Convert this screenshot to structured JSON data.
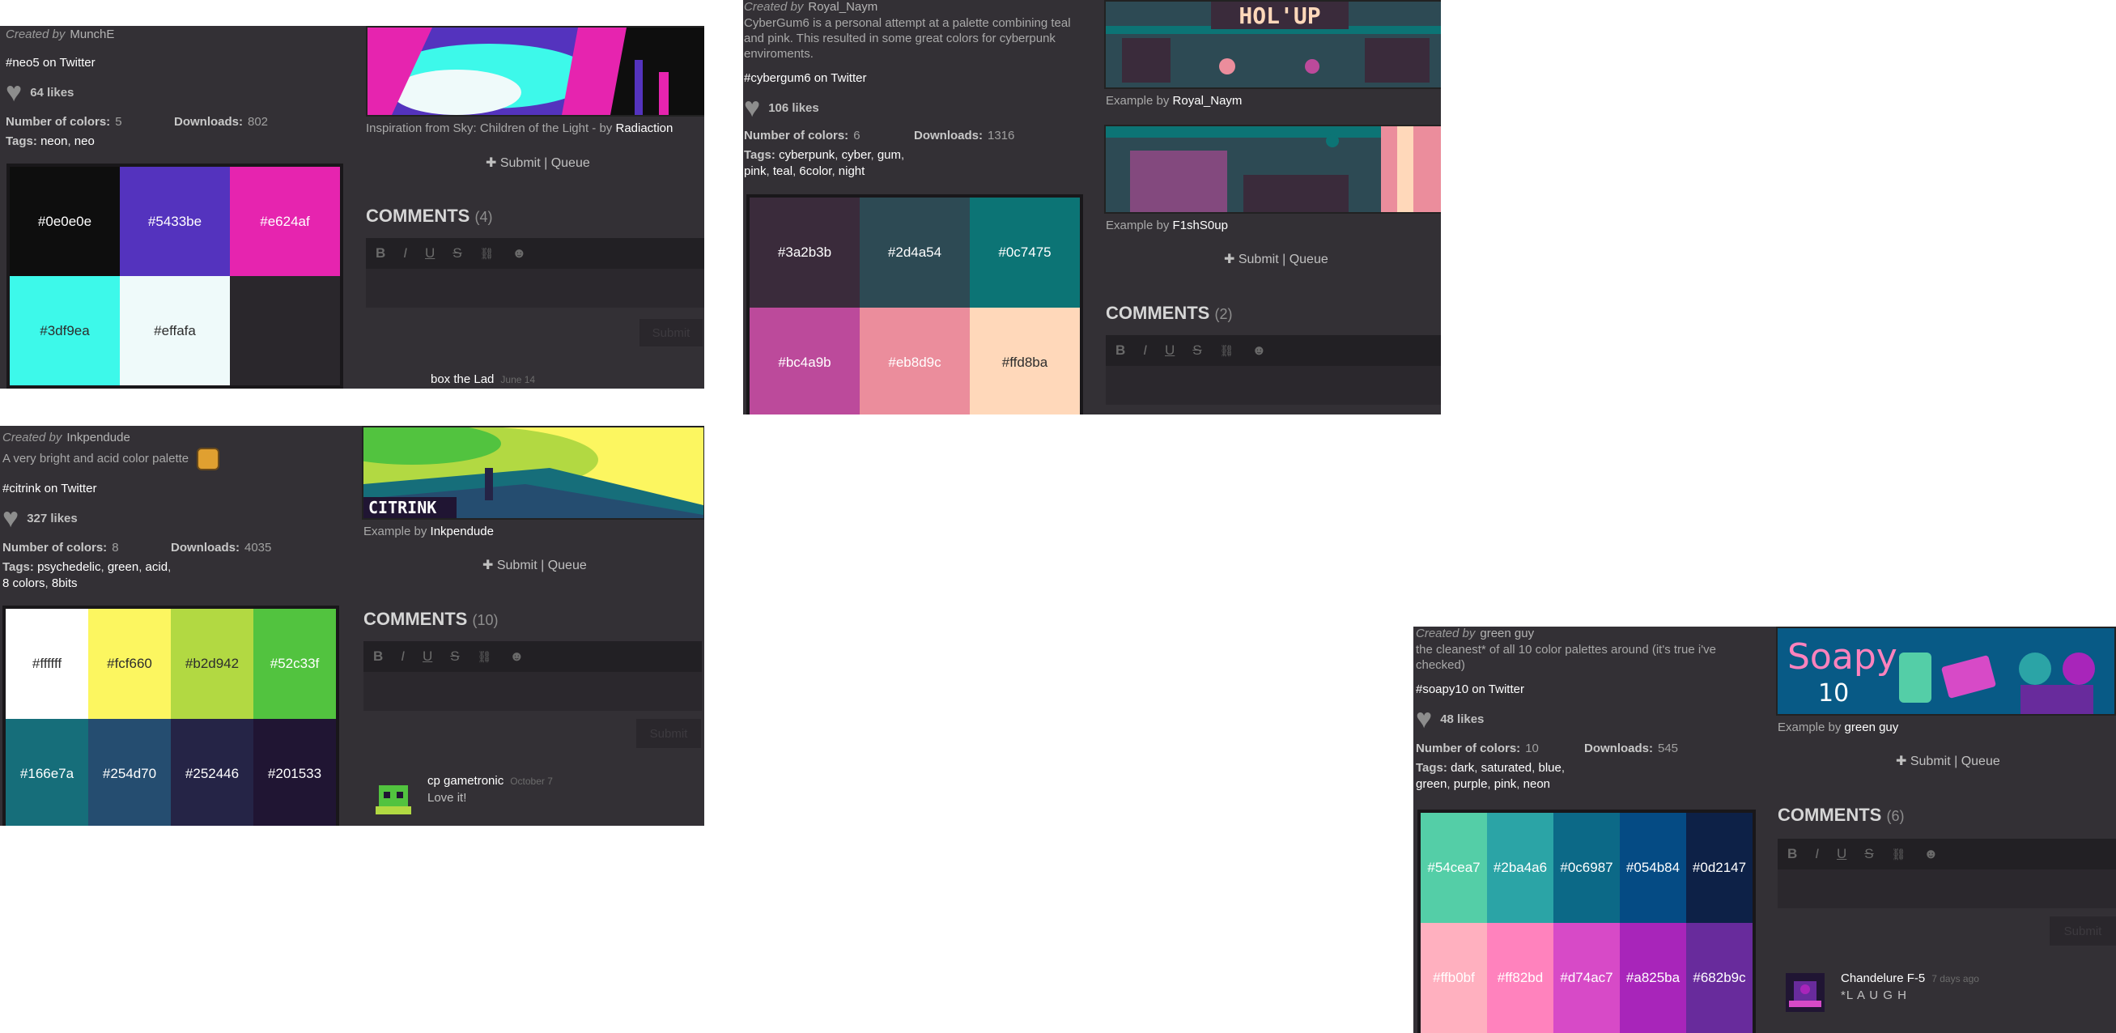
{
  "p1": {
    "created_by_label": "Created by",
    "creator": "MunchE",
    "twitter": "#neo5 on Twitter",
    "likes": "64 likes",
    "num_colors_label": "Number of colors:",
    "num_colors": "5",
    "downloads_label": "Downloads:",
    "downloads": "802",
    "tags_label": "Tags:",
    "tags": [
      "neon",
      "neo"
    ],
    "colors": [
      "#0e0e0e",
      "#5433be",
      "#e624af",
      "#3df9ea",
      "#effafa"
    ],
    "example_caption": "Inspiration from Sky: Children of the Light - by",
    "example_author": "Radiaction",
    "submit": "✚ Submit | Queue",
    "comments_label": "COMMENTS",
    "comments_count": "(4)",
    "submit_btn": "Submit",
    "comment_author": "box the Lad",
    "comment_date": "June 14"
  },
  "p2": {
    "created_by_label": "Created by",
    "creator": "Royal_Naym",
    "description": "CyberGum6 is a personal attempt at a palette combining teal and pink. This resulted in some great colors for cyberpunk enviroments.",
    "twitter": "#cybergum6 on Twitter",
    "likes": "106 likes",
    "num_colors_label": "Number of colors:",
    "num_colors": "6",
    "downloads_label": "Downloads:",
    "downloads": "1316",
    "tags_label": "Tags:",
    "tags": [
      "cyberpunk",
      "cyber",
      "gum",
      "pink",
      "teal",
      "6color",
      "night"
    ],
    "colors": [
      "#3a2b3b",
      "#2d4a54",
      "#0c7475",
      "#bc4a9b",
      "#eb8d9c",
      "#ffd8ba"
    ],
    "banner_text": "HOL'UP",
    "example1_prefix": "Example by",
    "example1_author": "Royal_Naym",
    "example2_prefix": "Example by",
    "example2_author": "F1shS0up",
    "submit": "✚ Submit | Queue",
    "comments_label": "COMMENTS",
    "comments_count": "(2)"
  },
  "p3": {
    "created_by_label": "Created by",
    "creator": "Inkpendude",
    "description": "A very bright and acid color palette",
    "twitter": "#citrink on Twitter",
    "likes": "327 likes",
    "num_colors_label": "Number of colors:",
    "num_colors": "8",
    "downloads_label": "Downloads:",
    "downloads": "4035",
    "tags_label": "Tags:",
    "tags": [
      "psychedelic",
      "green",
      "acid",
      "8 colors",
      "8bits"
    ],
    "colors": [
      "#ffffff",
      "#fcf660",
      "#b2d942",
      "#52c33f",
      "#166e7a",
      "#254d70",
      "#252446",
      "#201533"
    ],
    "banner_text": "CITRINK",
    "example_prefix": "Example by",
    "example_author": "Inkpendude",
    "submit": "✚ Submit | Queue",
    "comments_label": "COMMENTS",
    "comments_count": "(10)",
    "submit_btn": "Submit",
    "comment_author": "cp gametronic",
    "comment_date": "October 7",
    "comment_text": "Love it!"
  },
  "p4": {
    "created_by_label": "Created by",
    "creator": "green guy",
    "description": "the cleanest* of all 10 color palettes around (it's true i've checked)",
    "twitter": "#soapy10 on Twitter",
    "likes": "48 likes",
    "num_colors_label": "Number of colors:",
    "num_colors": "10",
    "downloads_label": "Downloads:",
    "downloads": "545",
    "tags_label": "Tags:",
    "tags": [
      "dark",
      "saturated",
      "blue",
      "green",
      "purple",
      "pink",
      "neon"
    ],
    "colors": [
      "#54cea7",
      "#2ba4a6",
      "#0c6987",
      "#054b84",
      "#0d2147",
      "#ffb0bf",
      "#ff82bd",
      "#d74ac7",
      "#a825ba",
      "#682b9c"
    ],
    "banner_title": "Soapy",
    "banner_num": "10",
    "example_prefix": "Example by",
    "example_author": "green guy",
    "submit": "✚ Submit | Queue",
    "comments_label": "COMMENTS",
    "comments_count": "(6)",
    "submit_btn": "Submit",
    "comment_author": "Chandelure F-5",
    "comment_date": "7 days ago",
    "comment_text": "*L A U G H"
  },
  "toolbar": {
    "bold": "B",
    "italic": "I",
    "underline": "U",
    "strike": "S",
    "link": "🔗",
    "emoji": "☻"
  },
  "icons": {
    "heart": "heart-icon",
    "plus": "plus-icon",
    "bold": "bold-icon",
    "italic": "italic-icon",
    "underline": "underline-icon",
    "strike": "strikethrough-icon",
    "link": "link-icon",
    "emoji": "emoji-icon"
  }
}
